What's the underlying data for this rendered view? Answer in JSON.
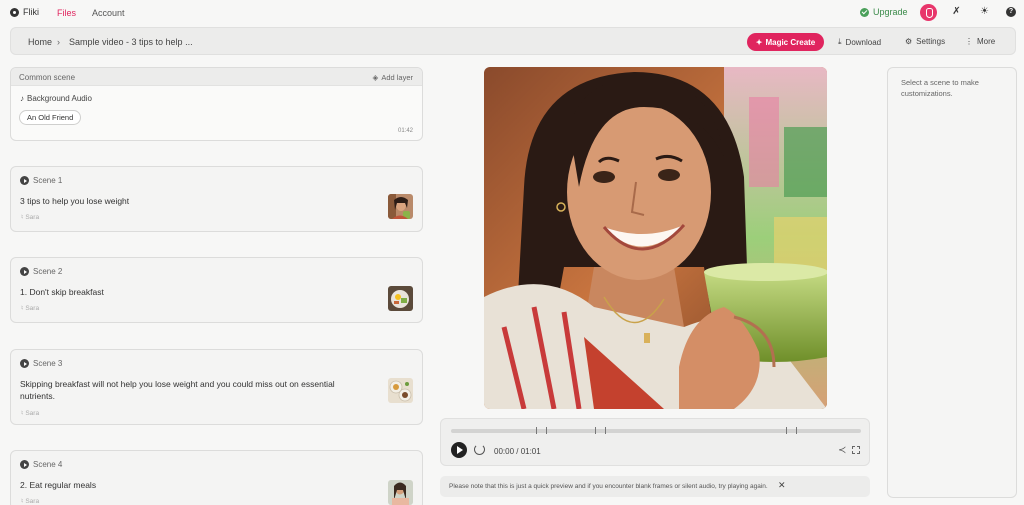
{
  "nav": {
    "brand": "Fliki",
    "files": "Files",
    "account": "Account",
    "upgrade": "Upgrade",
    "accent": "#e0245e"
  },
  "breadcrumb": {
    "home": "Home",
    "separator": "›",
    "title": "Sample video - 3 tips to help ..."
  },
  "toolbar": {
    "magic_create": "Magic Create",
    "download": "Download",
    "settings": "Settings",
    "more": "More"
  },
  "common_scene": {
    "label": "Common scene",
    "add_layer": "Add layer",
    "background_audio": "Background Audio",
    "song": "An Old Friend",
    "duration": "01:42"
  },
  "scenes": [
    {
      "label": "Scene 1",
      "text": "3 tips to help you lose weight",
      "voice": "Sara"
    },
    {
      "label": "Scene 2",
      "text": "1. Don't skip breakfast",
      "voice": "Sara"
    },
    {
      "label": "Scene 3",
      "text": "Skipping breakfast will not help you lose weight and you could miss out on essential nutrients.",
      "voice": "Sara"
    },
    {
      "label": "Scene 4",
      "text": "2. Eat regular meals",
      "voice": "Sara"
    }
  ],
  "player": {
    "time": "00:00 / 01:01"
  },
  "notice": {
    "text": "Please note that this is just a quick preview and if you encounter blank frames or silent audio, try playing again."
  },
  "right_panel": {
    "hint": "Select a scene to make customizations."
  }
}
